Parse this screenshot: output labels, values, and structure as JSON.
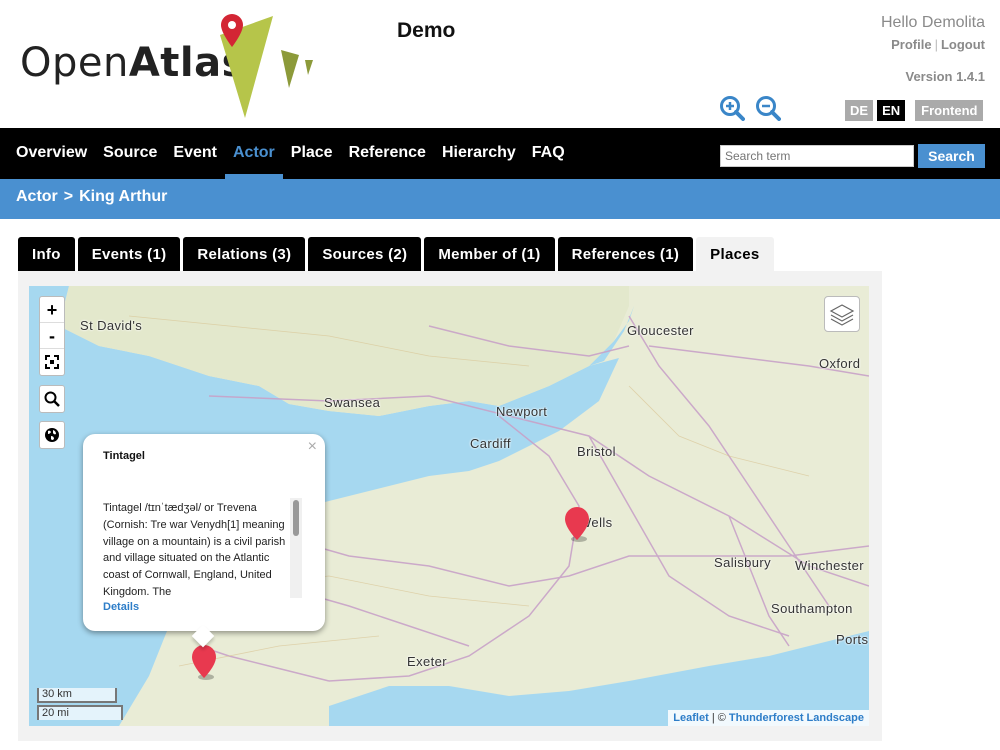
{
  "header": {
    "logo_part1": "Open",
    "logo_part2": "Atlas",
    "site_title": "Demo",
    "greeting": "Hello Demolita",
    "profile_link": "Profile",
    "link_separator": "|",
    "logout_link": "Logout",
    "version": "Version 1.4.1",
    "languages": [
      "DE",
      "EN"
    ],
    "active_language": "EN",
    "frontend_button": "Frontend"
  },
  "nav": {
    "items": [
      "Overview",
      "Source",
      "Event",
      "Actor",
      "Place",
      "Reference",
      "Hierarchy",
      "FAQ"
    ],
    "active": "Actor",
    "search_placeholder": "Search term",
    "search_button": "Search"
  },
  "breadcrumb": {
    "parent": "Actor",
    "separator": ">",
    "current": "King Arthur"
  },
  "tabs": [
    "Info",
    "Events (1)",
    "Relations (3)",
    "Sources (2)",
    "Member of (1)",
    "References (1)",
    "Places"
  ],
  "active_tab": "Places",
  "map": {
    "labels": [
      "St David's",
      "Gloucester",
      "Oxford",
      "Swansea",
      "Newport",
      "Cardiff",
      "Bristol",
      "Wells",
      "Salisbury",
      "Winchester",
      "Southampton",
      "Ports",
      "Exeter"
    ],
    "controls": {
      "zoom_in": "+",
      "zoom_out": "-"
    },
    "popup": {
      "title": "Tintagel",
      "close": "×",
      "text": "Tintagel /tɪnˈtædʒəl/ or Trevena (Cornish: Tre war Venydh[1] meaning village on a mountain) is a civil parish and village situated on the Atlantic coast of Cornwall, England, United Kingdom. The",
      "details_link": "Details"
    },
    "scale_km": "30 km",
    "scale_mi": "20 mi",
    "attribution_leaflet": "Leaflet",
    "attribution_sep": "| ©",
    "attribution_tiles": "Thunderforest Landscape",
    "colors": {
      "sea": "#a6d8f0",
      "land": "#e9ecd6",
      "roads": "#c8a2c8",
      "marker": "#e8394f"
    }
  },
  "colors": {
    "brand_blue": "#4a90d0",
    "nav_bg": "#000000",
    "logo_green": "#a8c040"
  }
}
